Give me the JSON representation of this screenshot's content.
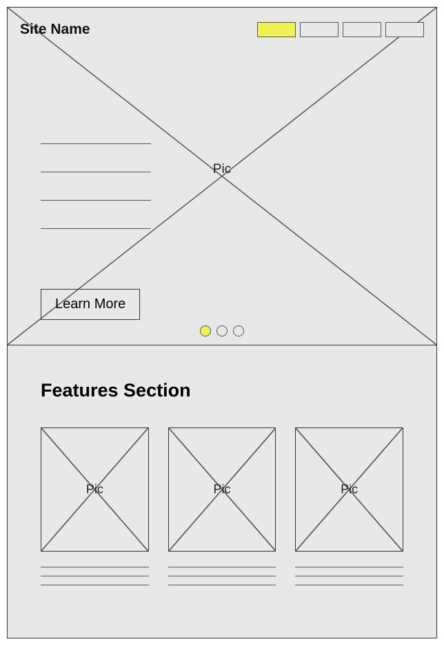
{
  "header": {
    "site_name": "Site Name",
    "nav_items": [
      {
        "active": true
      },
      {
        "active": false
      },
      {
        "active": false
      },
      {
        "active": false
      }
    ]
  },
  "hero": {
    "image_label": "Pic",
    "cta_label": "Learn More",
    "text_lines": 4,
    "carousel_dots": [
      {
        "active": true
      },
      {
        "active": false
      },
      {
        "active": false
      }
    ]
  },
  "features": {
    "heading": "Features Section",
    "cards": [
      {
        "image_label": "Pic",
        "text_lines": 3
      },
      {
        "image_label": "Pic",
        "text_lines": 3
      },
      {
        "image_label": "Pic",
        "text_lines": 3
      }
    ]
  },
  "colors": {
    "highlight": "#eef251"
  }
}
